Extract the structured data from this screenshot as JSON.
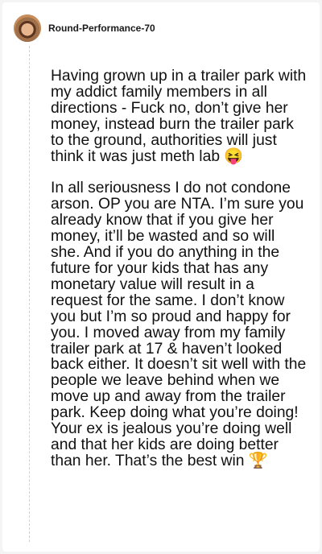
{
  "comment": {
    "author": "Round-Performance-70",
    "paragraphs": [
      "Having grown up in a trailer park with my addict family members in all directions - Fuck no, don’t give her money, instead burn the trailer park to the ground, authorities will just think it was just meth lab 😝",
      "In all seriousness I do not condone arson. OP you are NTA. I’m sure you already know that if you give her money, it’ll be wasted and so will she. And if you do anything in the future for your kids that has any monetary value will result in a request for the same. I don’t know you but I’m so proud and happy for you. I moved away from my family trailer park at 17 & haven’t looked back either. It doesn’t sit well with the people we leave behind when we move up and away from the trailer park. Keep doing what you’re doing! Your ex is jealous you’re doing well and that her kids are doing better than her. That’s the best win 🏆"
    ]
  }
}
